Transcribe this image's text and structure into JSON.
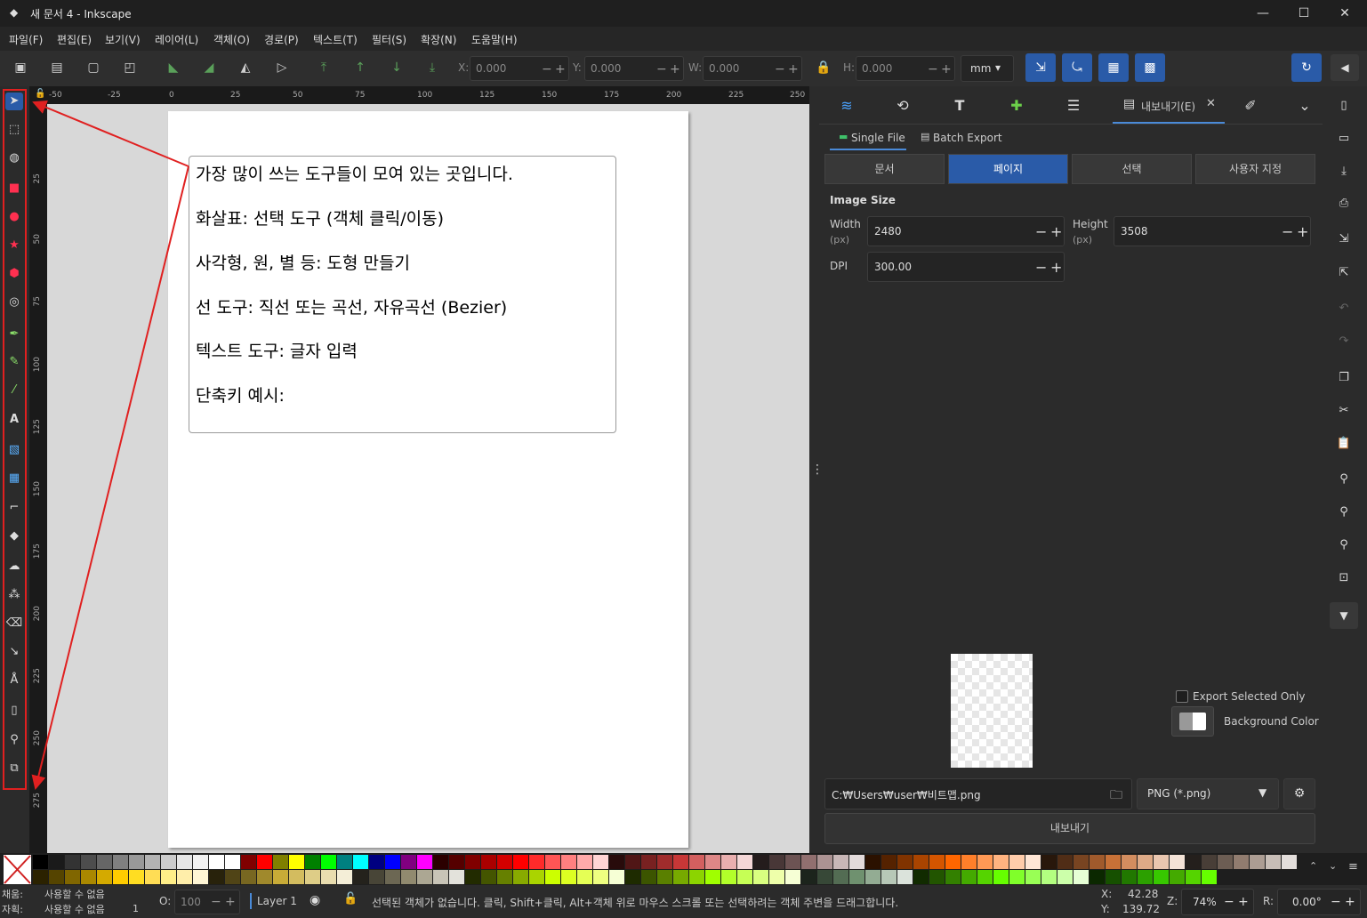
{
  "window": {
    "title": "새 문서 4 - Inkscape",
    "minimize": "—",
    "maximize": "☐",
    "close": "✕"
  },
  "menu": [
    "파일(F)",
    "편집(E)",
    "보기(V)",
    "레이어(L)",
    "객체(O)",
    "경로(P)",
    "텍스트(T)",
    "필터(S)",
    "확장(N)",
    "도움말(H)"
  ],
  "toolbar": {
    "x_label": "X:",
    "x_value": "0.000",
    "y_label": "Y:",
    "y_value": "0.000",
    "w_label": "W:",
    "w_value": "0.000",
    "h_label": "H:",
    "h_value": "0.000",
    "unit": "mm"
  },
  "ruler": {
    "h_ticks": [
      "-50",
      "-25",
      "0",
      "25",
      "50",
      "75",
      "100",
      "125",
      "150",
      "175",
      "200",
      "225",
      "250"
    ],
    "v_ticks": [
      "25",
      "50",
      "75",
      "100",
      "125",
      "150",
      "175",
      "200",
      "225",
      "250",
      "275"
    ]
  },
  "canvas": {
    "lines": [
      "가장 많이 쓰는 도구들이 모여 있는 곳입니다.",
      "화살표: 선택 도구 (객체 클릭/이동)",
      "사각형, 원, 별 등: 도형 만들기",
      "선 도구: 직선 또는 곡선, 자유곡선 (Bezier)",
      "텍스트 도구:  글자 입력",
      "단축키 예시:"
    ]
  },
  "export_panel": {
    "tab_label": "내보내기(E)",
    "subtabs": [
      "Single File",
      "Batch Export"
    ],
    "scope_tabs": [
      "문서",
      "페이지",
      "선택",
      "사용자 지정"
    ],
    "active_scope": "페이지",
    "image_size_title": "Image Size",
    "width_label": "Width",
    "width_unit": "(px)",
    "width_value": "2480",
    "height_label": "Height",
    "height_unit": "(px)",
    "height_value": "3508",
    "dpi_label": "DPI",
    "dpi_value": "300.00",
    "export_selected_only": "Export Selected Only",
    "background_color": "Background Color",
    "file_path": "C:₩Users₩user₩비트맵.png",
    "format": "PNG (*.png)",
    "export_button": "내보내기"
  },
  "status": {
    "fill_label": "채움:",
    "fill_value": "사용할 수 없음",
    "stroke_label": "자획:",
    "stroke_value": "사용할 수 없음",
    "stroke_width": "1",
    "opacity_label": "O:",
    "opacity_value": "100",
    "layer": "Layer 1",
    "message": "선택된 객체가 없습니다. 클릭, Shift+클릭, Alt+객체 위로 마우스 스크롤 또는 선택하려는 객체 주변을 드래그합니다.",
    "x_label": "X:",
    "x_value": "42.28",
    "y_label": "Y:",
    "y_value": "139.72",
    "zoom_label": "Z:",
    "zoom_value": "74%",
    "rotate_label": "R:",
    "rotate_value": "0.00°"
  },
  "colors": {
    "accent": "#2a5ba8",
    "highlight": "#e02020"
  }
}
